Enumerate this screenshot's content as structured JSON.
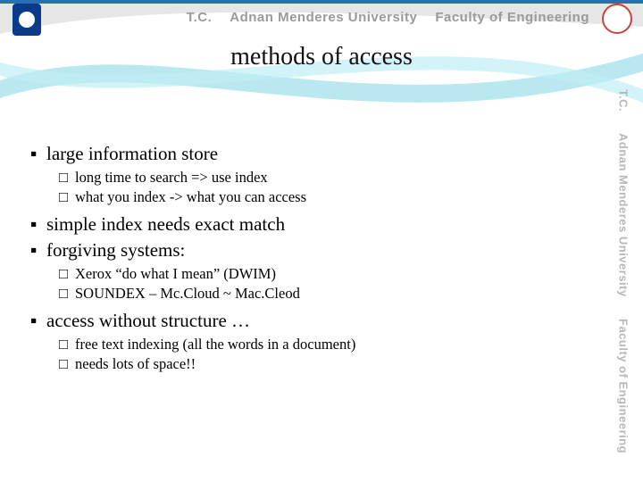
{
  "header": {
    "tc": "T.C.",
    "university": "Adnan Menderes University",
    "faculty": "Faculty of Engineering"
  },
  "rightbar": {
    "tc": "T.C.",
    "university": "Adnan Menderes University",
    "faculty": "Faculty of Engineering"
  },
  "title": "methods of access",
  "bullets": [
    {
      "text": "large information store",
      "sub": [
        "long time to search  =>   use index",
        "what you index    ->   what you can access"
      ]
    },
    {
      "text": "simple index needs exact match",
      "sub": []
    },
    {
      "text": "forgiving systems:",
      "sub": [
        "Xerox “do what I mean” (DWIM)",
        "SOUNDEX – Mc.Cloud ~ Mac.Cleod"
      ]
    },
    {
      "text": "access without structure …",
      "sub": [
        "free text indexing (all the words in a document)",
        "needs lots of space!!"
      ]
    }
  ]
}
